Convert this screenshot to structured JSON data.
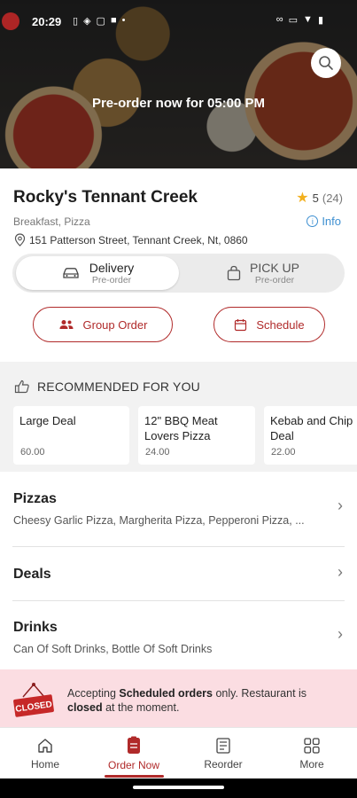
{
  "status_bar": {
    "time": "20:29"
  },
  "hero": {
    "preorder_text": "Pre-order now for 05:00 PM"
  },
  "restaurant": {
    "name": "Rocky's Tennant Creek",
    "rating": "5",
    "rating_count": "(24)",
    "cuisine": "Breakfast, Pizza",
    "info_label": "Info",
    "address": "151 Patterson Street, Tennant Creek, Nt, 0860"
  },
  "order_mode": {
    "delivery": {
      "title": "Delivery",
      "sub": "Pre-order"
    },
    "pickup": {
      "title": "PICK UP",
      "sub": "Pre-order"
    }
  },
  "actions": {
    "group_order": "Group Order",
    "schedule": "Schedule"
  },
  "recommended": {
    "heading": "RECOMMENDED FOR YOU",
    "items": [
      {
        "name": "Large Deal",
        "price": "60.00"
      },
      {
        "name": "12\" BBQ Meat Lovers Pizza",
        "price": "24.00"
      },
      {
        "name": "Kebab and Chip Deal",
        "price": "22.00"
      }
    ]
  },
  "categories": [
    {
      "title": "Pizzas",
      "desc": "Cheesy Garlic Pizza, Margherita Pizza, Pepperoni Pizza, ..."
    },
    {
      "title": "Deals",
      "desc": ""
    },
    {
      "title": "Drinks",
      "desc": "Can Of Soft Drinks, Bottle Of Soft Drinks"
    }
  ],
  "closed_banner": {
    "sign": "CLOSED",
    "text_1": "Accepting ",
    "text_bold_1": "Scheduled orders",
    "text_2": " only. Restaurant is ",
    "text_bold_2": "closed",
    "text_3": " at the moment."
  },
  "bottom_nav": {
    "home": "Home",
    "order_now": "Order Now",
    "reorder": "Reorder",
    "more": "More",
    "active": "order_now"
  },
  "colors": {
    "accent": "#b02a2a",
    "info": "#3d8fd1",
    "star": "#f2b01e",
    "banner_bg": "#fbdde2"
  }
}
